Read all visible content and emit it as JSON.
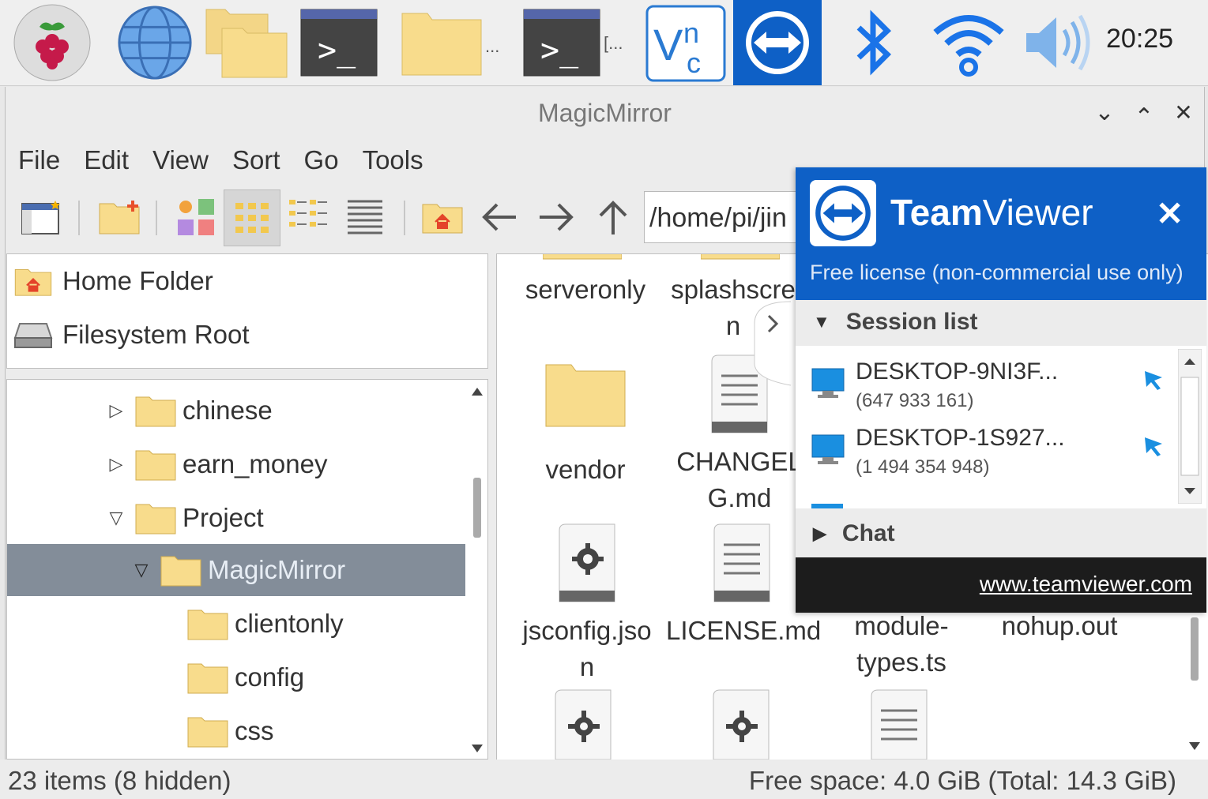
{
  "taskbar": {
    "clock": "20:25",
    "ellipsis_1": "...",
    "ellipsis_2": "[..."
  },
  "window": {
    "title": "MagicMirror",
    "menus": [
      "File",
      "Edit",
      "View",
      "Sort",
      "Go",
      "Tools"
    ],
    "path": "/home/pi/jin"
  },
  "places": [
    {
      "label": "Home Folder",
      "icon": "home-icon"
    },
    {
      "label": "Filesystem Root",
      "icon": "drive-icon"
    }
  ],
  "tree": [
    {
      "label": "chinese",
      "expander": "▷"
    },
    {
      "label": "earn_money",
      "expander": "▷"
    },
    {
      "label": "Project",
      "expander": "▽"
    },
    {
      "label": "MagicMirror",
      "expander": "▽"
    },
    {
      "label": "clientonly",
      "expander": ""
    },
    {
      "label": "config",
      "expander": ""
    },
    {
      "label": "css",
      "expander": ""
    }
  ],
  "files": [
    {
      "label": "serveronly",
      "type": "folder"
    },
    {
      "label": "splashscreen",
      "label_line1": "splashscre",
      "label_line2": "n",
      "type": "folder"
    },
    {
      "label": "vendor",
      "type": "folder"
    },
    {
      "label_line1": "CHANGEL",
      "label_line2": "G.md",
      "type": "text"
    },
    {
      "label_line1": "jsconfig.jso",
      "label_line2": "n",
      "type": "config"
    },
    {
      "label": "LICENSE.md",
      "type": "text"
    },
    {
      "label_line1": "module-",
      "label_line2": "types.ts",
      "type": "text"
    },
    {
      "label": "nohup.out",
      "type": "text"
    }
  ],
  "status": {
    "left": "23 items (8 hidden)",
    "right": "Free space: 4.0 GiB (Total: 14.3 GiB)"
  },
  "teamviewer": {
    "brand_bold": "Team",
    "brand_rest": "Viewer",
    "close": "✕",
    "license": "Free license (non-commercial use only)",
    "session_list": "Session list",
    "sessions": [
      {
        "name": "DESKTOP-9NI3F...",
        "id": "(647 933 161)"
      },
      {
        "name": "DESKTOP-1S927...",
        "id": "(1 494 354 948)"
      }
    ],
    "chat": "Chat",
    "url": "www.teamviewer.com"
  },
  "colors": {
    "teamviewer_blue": "#0e60c6",
    "folder_yellow": "#f8dc8c",
    "selection": "#838d99"
  }
}
